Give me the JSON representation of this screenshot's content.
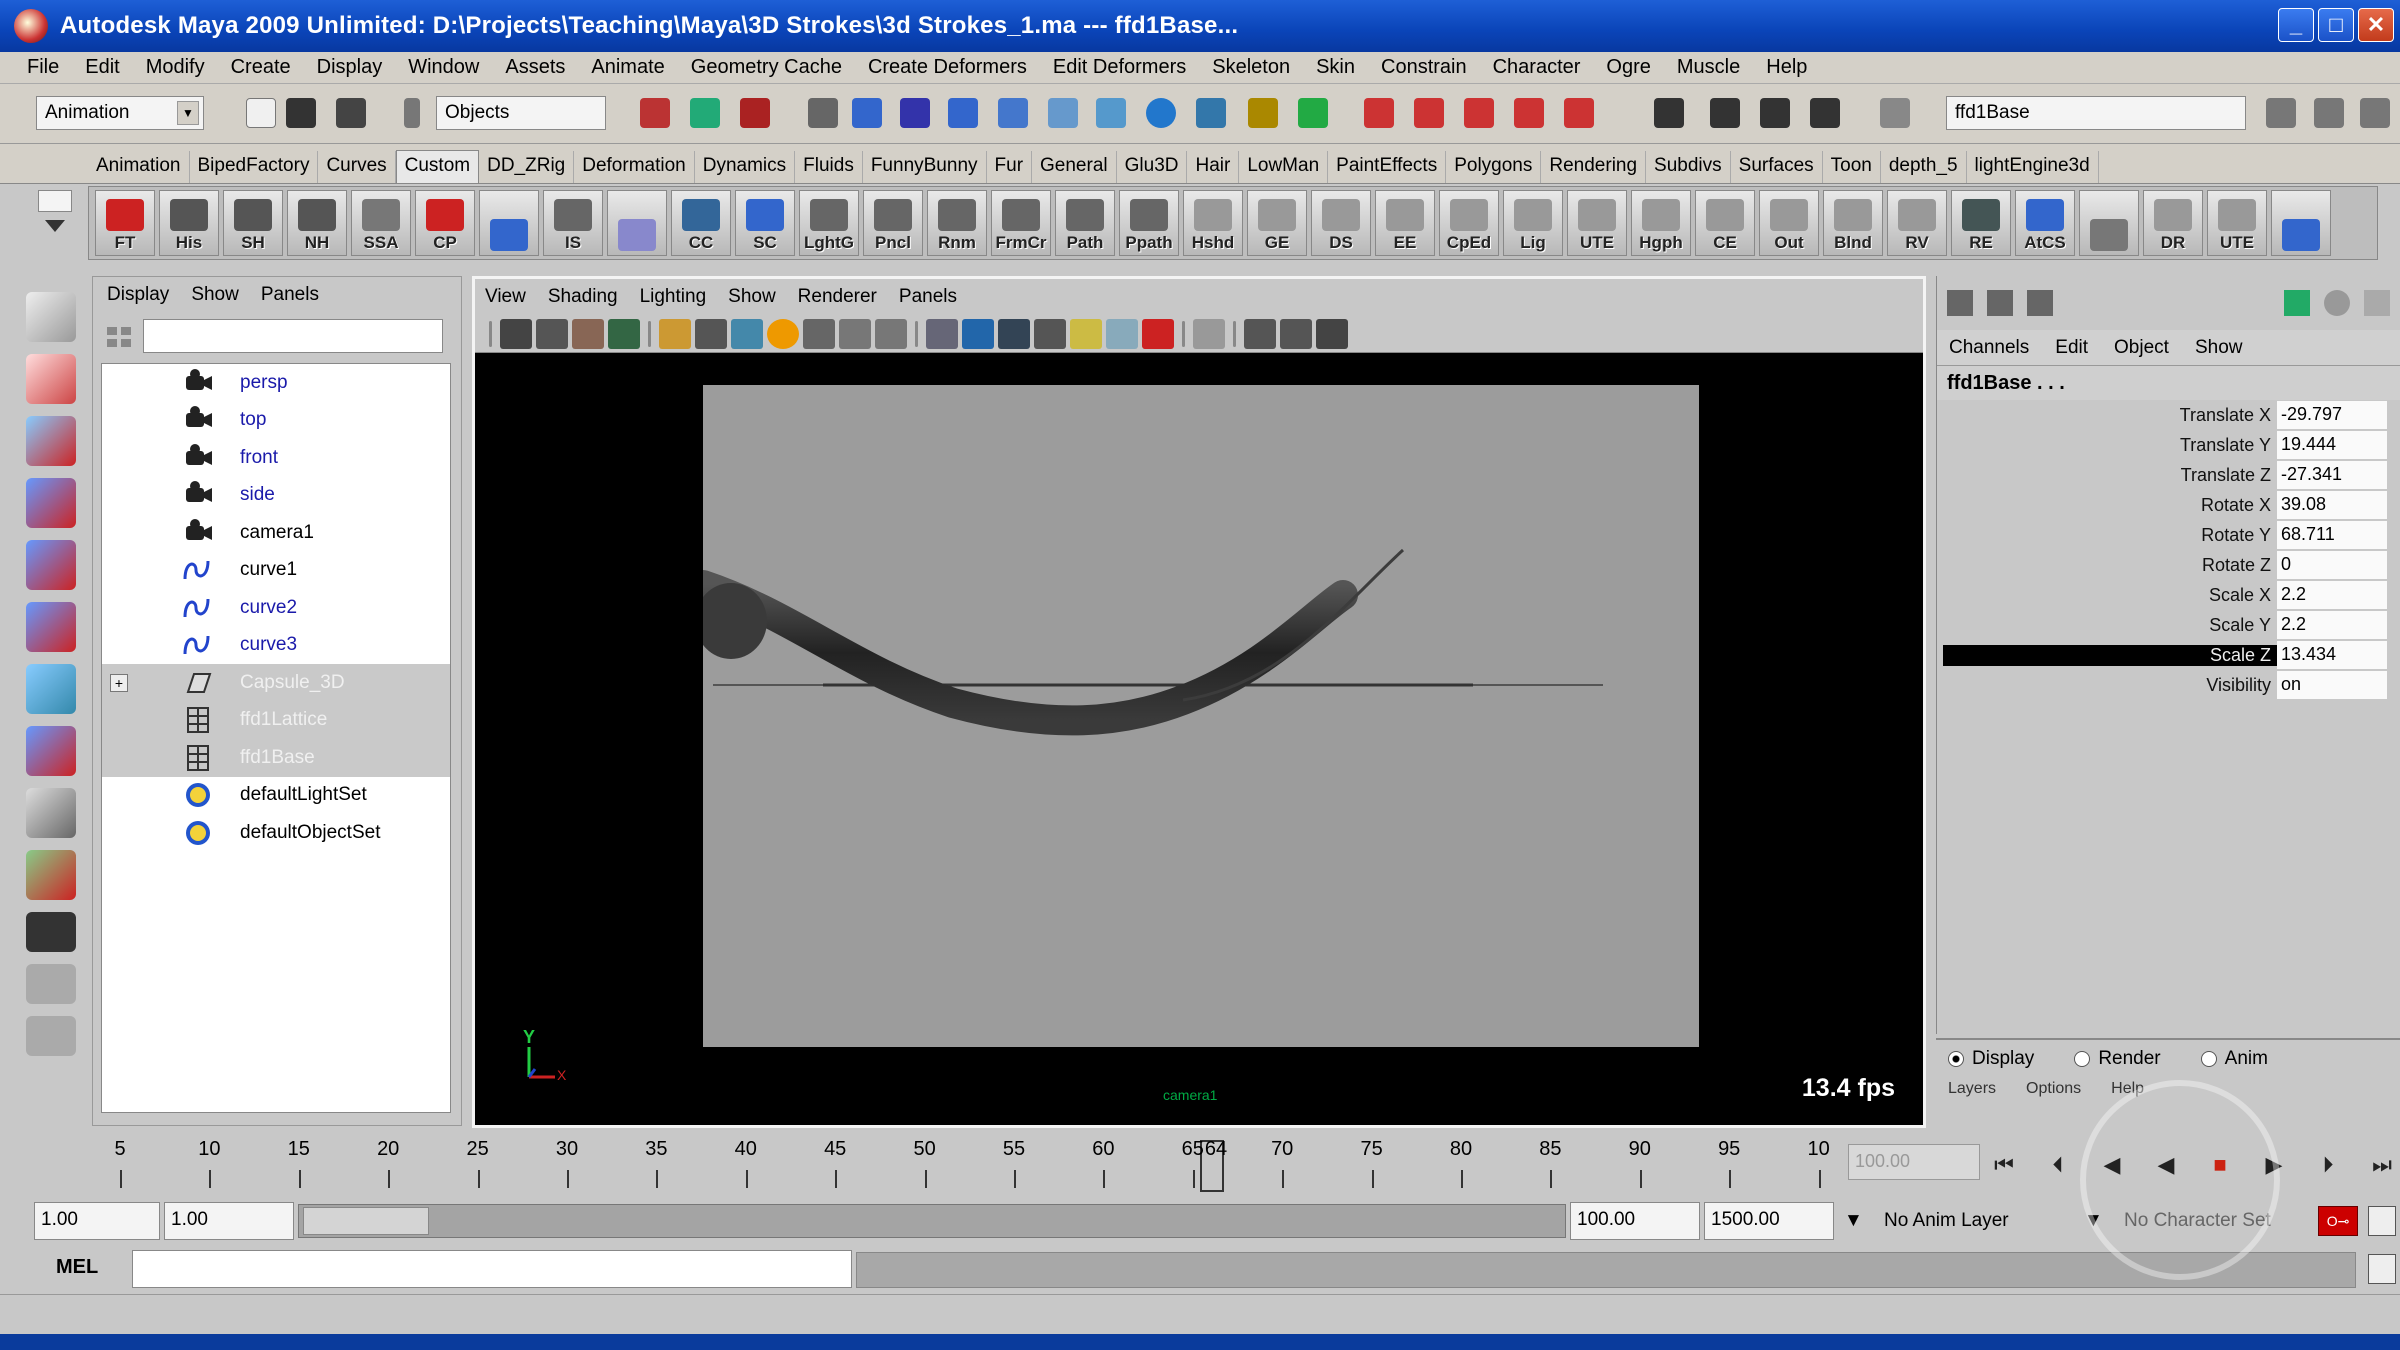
{
  "window": {
    "title": "Autodesk Maya 2009 Unlimited: D:\\Projects\\Teaching\\Maya\\3D Strokes\\3d Strokes_1.ma   ---   ffd1Base...",
    "buttons": [
      "_",
      "□",
      "✕"
    ]
  },
  "menubar": [
    "File",
    "Edit",
    "Modify",
    "Create",
    "Display",
    "Window",
    "Assets",
    "Animate",
    "Geometry Cache",
    "Create Deformers",
    "Edit Deformers",
    "Skeleton",
    "Skin",
    "Constrain",
    "Character",
    "Ogre",
    "Muscle",
    "Help"
  ],
  "statusline": {
    "mode": "Animation",
    "selection_mask": "Objects",
    "quick_select": "ffd1Base"
  },
  "shelf_tabs": [
    "Animation",
    "BipedFactory",
    "Curves",
    "Custom",
    "DD_ZRig",
    "Deformation",
    "Dynamics",
    "Fluids",
    "FunnyBunny",
    "Fur",
    "General",
    "Glu3D",
    "Hair",
    "LowMan",
    "PaintEffects",
    "Polygons",
    "Rendering",
    "Subdivs",
    "Surfaces",
    "Toon",
    "depth_5",
    "lightEngine3d"
  ],
  "active_shelf_tab": "Custom",
  "shelf_buttons": [
    "FT",
    "His",
    "SH",
    "NH",
    "SSA",
    "CP",
    "",
    "IS",
    "",
    "CC",
    "SC",
    "LghtG",
    "Pncl",
    "Rnm",
    "FrmCr",
    "Path",
    "Ppath",
    "Hshd",
    "GE",
    "DS",
    "EE",
    "CpEd",
    "Lig",
    "UTE",
    "Hgph",
    "CE",
    "Out",
    "Blnd",
    "RV",
    "RE",
    "AtCS",
    "",
    "DR",
    "UTE",
    ""
  ],
  "outliner": {
    "menu": [
      "Display",
      "Show",
      "Panels"
    ],
    "items": [
      {
        "name": "persp",
        "icon": "camera-icon",
        "selected": false,
        "color": "blue"
      },
      {
        "name": "top",
        "icon": "camera-icon",
        "selected": false,
        "color": "blue"
      },
      {
        "name": "front",
        "icon": "camera-icon",
        "selected": false,
        "color": "blue"
      },
      {
        "name": "side",
        "icon": "camera-icon",
        "selected": false,
        "color": "blue"
      },
      {
        "name": "camera1",
        "icon": "camera-icon",
        "selected": false,
        "color": "black"
      },
      {
        "name": "curve1",
        "icon": "curve-icon",
        "selected": false,
        "color": "black"
      },
      {
        "name": "curve2",
        "icon": "curve-icon",
        "selected": false,
        "color": "blue"
      },
      {
        "name": "curve3",
        "icon": "curve-icon",
        "selected": false,
        "color": "blue"
      },
      {
        "name": "Capsule_3D",
        "icon": "poly-icon",
        "selected": true,
        "color": "white",
        "expander": "+"
      },
      {
        "name": "ffd1Lattice",
        "icon": "lattice-icon",
        "selected": true,
        "color": "white"
      },
      {
        "name": "ffd1Base",
        "icon": "lattice-icon",
        "selected": true,
        "color": "white"
      },
      {
        "name": "defaultLightSet",
        "icon": "set-icon",
        "selected": false,
        "color": "black"
      },
      {
        "name": "defaultObjectSet",
        "icon": "set-icon",
        "selected": false,
        "color": "black"
      }
    ]
  },
  "viewport": {
    "menu": [
      "View",
      "Shading",
      "Lighting",
      "Show",
      "Renderer",
      "Panels"
    ],
    "fps": "13.4 fps",
    "camera_label": "camera1",
    "axis_y": "Y",
    "axis_x": "X"
  },
  "channel_box": {
    "menu": [
      "Channels",
      "Edit",
      "Object",
      "Show"
    ],
    "node": "ffd1Base . . .",
    "channels": [
      {
        "attr": "Translate X",
        "value": "-29.797",
        "selected": false
      },
      {
        "attr": "Translate Y",
        "value": "19.444",
        "selected": false
      },
      {
        "attr": "Translate Z",
        "value": "-27.341",
        "selected": false
      },
      {
        "attr": "Rotate X",
        "value": "39.08",
        "selected": false
      },
      {
        "attr": "Rotate Y",
        "value": "68.711",
        "selected": false
      },
      {
        "attr": "Rotate Z",
        "value": "0",
        "selected": false
      },
      {
        "attr": "Scale X",
        "value": "2.2",
        "selected": false
      },
      {
        "attr": "Scale Y",
        "value": "2.2",
        "selected": false
      },
      {
        "attr": "Scale Z",
        "value": "13.434",
        "selected": true
      },
      {
        "attr": "Visibility",
        "value": "on",
        "selected": false
      }
    ]
  },
  "layer_editor": {
    "modes": [
      "Display",
      "Render",
      "Anim"
    ],
    "active_mode": "Display",
    "submenu": [
      "Layers",
      "Options",
      "Help"
    ],
    "arrows": [
      "<<",
      ">>"
    ]
  },
  "timeline": {
    "ticks": [
      "5",
      "10",
      "15",
      "20",
      "25",
      "30",
      "35",
      "40",
      "45",
      "50",
      "55",
      "60",
      "65",
      "70",
      "75",
      "80",
      "85",
      "90",
      "95",
      "10"
    ],
    "current_frame": "64",
    "current_frame_field": "100.00"
  },
  "range": {
    "start_time": "1.00",
    "playback_start": "1.00",
    "playback_end": "100.00",
    "end_time": "1500.00",
    "anim_layer": "No Anim Layer",
    "character_set": "No Character Set"
  },
  "command_line": {
    "label": "MEL"
  },
  "colors": {
    "title_bar": "#0a44b8",
    "ui_gray": "#c8c8c8",
    "viewport_bg": "#000000",
    "resolution_gate": "#9c9c9c",
    "selection": "#000000"
  }
}
